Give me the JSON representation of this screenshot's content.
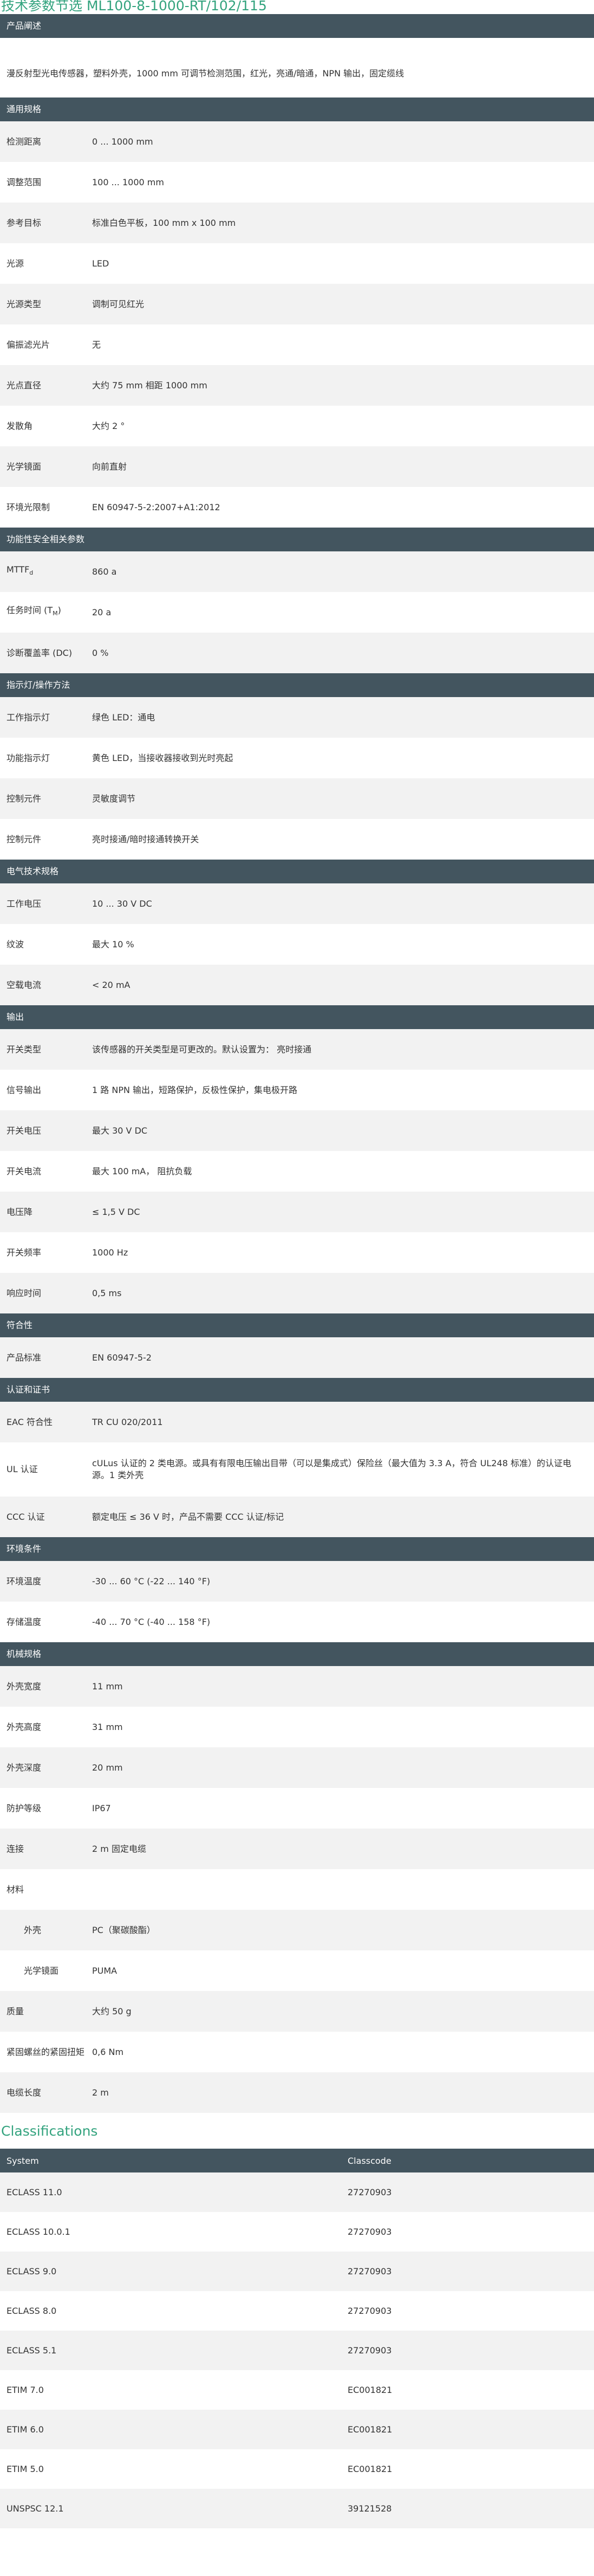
{
  "page_title": "技术参数节选  ML100-8-1000-RT/102/115",
  "product_description": {
    "header": "产品阐述",
    "text": "漫反射型光电传感器，塑料外壳，1000 mm 可调节检测范围，红光，亮通/暗通，NPN 输出，固定缆线"
  },
  "sections": [
    {
      "header": "通用规格",
      "rows": [
        {
          "label": "检测距离",
          "value": "0 ... 1000 mm"
        },
        {
          "label": "调整范围",
          "value": "100 ... 1000 mm"
        },
        {
          "label": "参考目标",
          "value": "标准白色平板，100 mm x 100 mm"
        },
        {
          "label": "光源",
          "value": "LED"
        },
        {
          "label": "光源类型",
          "value": "调制可见红光"
        },
        {
          "label": "偏振滤光片",
          "value": "无"
        },
        {
          "label": "光点直径",
          "value": "大约 75 mm 相距 1000 mm"
        },
        {
          "label": "发散角",
          "value": "大约 2 °"
        },
        {
          "label": "光学镜面",
          "value": "向前直射"
        },
        {
          "label": "环境光限制",
          "value": "EN 60947-5-2:2007+A1:2012"
        }
      ]
    },
    {
      "header": "功能性安全相关参数",
      "rows": [
        {
          "label": "MTTF",
          "label_sub": "d",
          "value": "860 a"
        },
        {
          "label": "任务时间 (T",
          "label_sub": "M",
          "label_suffix": ")",
          "value": "20 a"
        },
        {
          "label": "诊断覆盖率 (DC)",
          "value": "0 %"
        }
      ]
    },
    {
      "header": "指示灯/操作方法",
      "rows": [
        {
          "label": "工作指示灯",
          "value": "绿色 LED：通电"
        },
        {
          "label": "功能指示灯",
          "value": "黄色 LED，当接收器接收到光时亮起"
        },
        {
          "label": "控制元件",
          "value": "灵敏度调节"
        },
        {
          "label": "控制元件",
          "value": "亮时接通/暗时接通转换开关"
        }
      ]
    },
    {
      "header": "电气技术规格",
      "rows": [
        {
          "label": "工作电压",
          "value": "10 ... 30 V DC"
        },
        {
          "label": "纹波",
          "value": "最大 10 %"
        },
        {
          "label": "空载电流",
          "value": "< 20 mA"
        }
      ]
    },
    {
      "header": "输出",
      "rows": [
        {
          "label": "开关类型",
          "value": "该传感器的开关类型是可更改的。默认设置为： 亮时接通"
        },
        {
          "label": "信号输出",
          "value": "1 路 NPN 输出，短路保护，反极性保护，集电极开路"
        },
        {
          "label": "开关电压",
          "value": "最大 30 V DC"
        },
        {
          "label": "开关电流",
          "value": "最大 100 mA， 阻抗负载"
        },
        {
          "label": "电压降",
          "value": "≤ 1,5 V DC"
        },
        {
          "label": "开关频率",
          "value": "1000 Hz"
        },
        {
          "label": "响应时间",
          "value": "0,5 ms"
        }
      ]
    },
    {
      "header": "符合性",
      "rows": [
        {
          "label": "产品标准",
          "value": "EN 60947-5-2"
        }
      ]
    },
    {
      "header": "认证和证书",
      "rows": [
        {
          "label": "EAC 符合性",
          "value": "TR CU 020/2011"
        },
        {
          "label": "UL 认证",
          "value": "cULus 认证的 2 类电源。或具有有限电压输出目带（可以是集成式）保险丝（最大值为 3.3 A，符合 UL248 标准）的认证电源。1 类外壳",
          "tall": true
        },
        {
          "label": "CCC 认证",
          "value": "额定电压 ≤ 36 V 时，产品不需要 CCC 认证/标记"
        }
      ]
    },
    {
      "header": "环境条件",
      "rows": [
        {
          "label": "环境温度",
          "value": "-30 ... 60 °C (-22 ... 140 °F)"
        },
        {
          "label": "存储温度",
          "value": "-40 ... 70 °C (-40 ... 158 °F)"
        }
      ]
    },
    {
      "header": "机械规格",
      "rows": [
        {
          "label": "外壳宽度",
          "value": "11 mm"
        },
        {
          "label": "外壳高度",
          "value": "31 mm"
        },
        {
          "label": "外壳深度",
          "value": "20 mm"
        },
        {
          "label": "防护等级",
          "value": "IP67"
        },
        {
          "label": "连接",
          "value": "2 m 固定电缆"
        },
        {
          "label": "材料",
          "value": ""
        },
        {
          "label": "外壳",
          "value": "PC（聚碳酸酯）",
          "sub": true
        },
        {
          "label": "光学镜面",
          "value": "PUMA",
          "sub": true
        },
        {
          "label": "质量",
          "value": "大约 50 g"
        },
        {
          "label": "紧固螺丝的紧固扭矩",
          "value": "0,6 Nm"
        },
        {
          "label": "电缆长度",
          "value": "2 m"
        }
      ]
    }
  ],
  "classifications": {
    "title": "Classifications",
    "col_system": "System",
    "col_classcode": "Classcode",
    "rows": [
      {
        "system": "ECLASS 11.0",
        "code": "27270903"
      },
      {
        "system": "ECLASS 10.0.1",
        "code": "27270903"
      },
      {
        "system": "ECLASS 9.0",
        "code": "27270903"
      },
      {
        "system": "ECLASS 8.0",
        "code": "27270903"
      },
      {
        "system": "ECLASS 5.1",
        "code": "27270903"
      },
      {
        "system": "ETIM 7.0",
        "code": "EC001821"
      },
      {
        "system": "ETIM 6.0",
        "code": "EC001821"
      },
      {
        "system": "ETIM 5.0",
        "code": "EC001821"
      },
      {
        "system": "UNSPSC 12.1",
        "code": "39121528"
      }
    ]
  }
}
